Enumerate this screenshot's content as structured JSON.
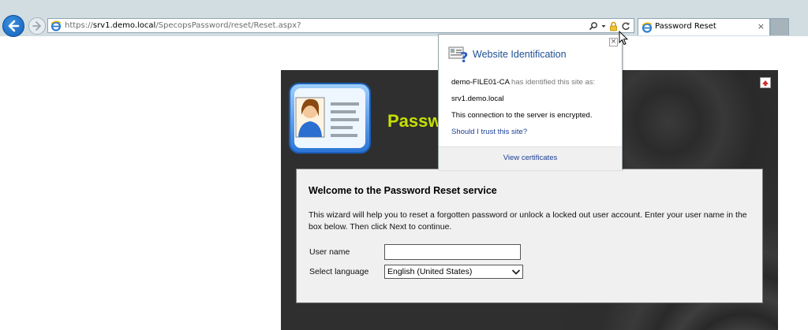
{
  "browser": {
    "url_prefix": "https://",
    "url_host": "srv1.demo.local",
    "url_path": "/SpecopsPassword/reset/Reset.aspx?",
    "tab_title": "Password Reset",
    "tab_close": "×",
    "icons": [
      "back-arrow-icon",
      "forward-arrow-icon",
      "ie-icon",
      "search-icon",
      "dropdown-icon",
      "lock-icon",
      "refresh-icon",
      "close-icon"
    ]
  },
  "app": {
    "title": "Passw"
  },
  "form": {
    "heading": "Welcome to the Password Reset service",
    "description": "This wizard will help you to reset a forgotten password or unlock a locked out user account. Enter your user name in the box below. Then click Next to continue.",
    "username_label": "User name",
    "username_value": "",
    "language_label": "Select language",
    "language_value": "English (United States)"
  },
  "popup": {
    "title": "Website Identification",
    "issuer": "demo-FILE01-CA",
    "issuer_suffix": "has identified this site as:",
    "site": "srv1.demo.local",
    "encryption_note": "This connection to the server is encrypted.",
    "trust_link": "Should I trust this site?",
    "view_certificates": "View certificates",
    "close": "×"
  },
  "colors": {
    "chrome_bg": "#d2dde2",
    "accent_title": "#c6e000",
    "link": "#1c3f94",
    "panel_bg": "#2f2f2f"
  }
}
